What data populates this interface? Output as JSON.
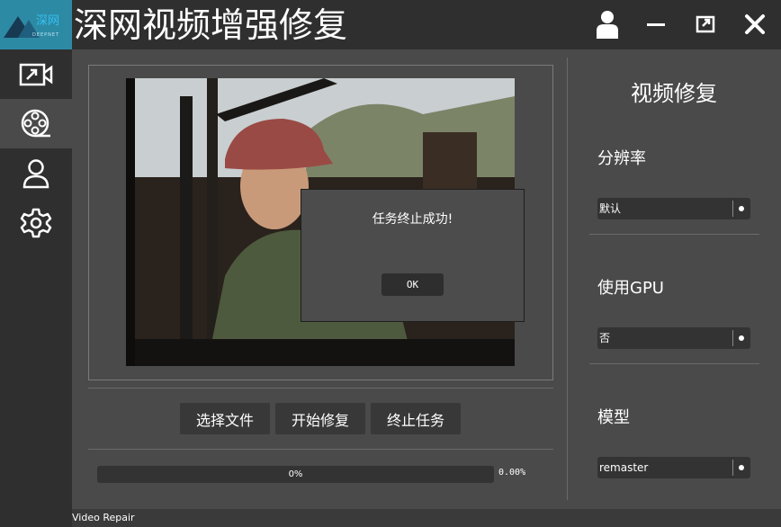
{
  "app": {
    "logo_brand": "深网",
    "logo_sub": "DEEPNET",
    "title": "深网视频增强修复"
  },
  "window_controls": [
    "user-icon",
    "minimize-icon",
    "restore-icon",
    "close-icon"
  ],
  "sidebar": {
    "items": [
      {
        "name": "video-import",
        "icon": "video-arrow-icon"
      },
      {
        "name": "video-repair",
        "icon": "film-reel-icon",
        "active": true
      },
      {
        "name": "user",
        "icon": "user-icon"
      },
      {
        "name": "settings",
        "icon": "gear-icon"
      }
    ]
  },
  "actions": {
    "select_file": "选择文件",
    "start_repair": "开始修复",
    "stop_task": "终止任务"
  },
  "progress": {
    "bar_label": "0%",
    "percent_text": "0.00%",
    "value": 0
  },
  "dialog": {
    "message": "任务终止成功!",
    "ok_label": "OK"
  },
  "settings_panel": {
    "title": "视频修复",
    "resolution": {
      "label": "分辨率",
      "value": "默认"
    },
    "gpu": {
      "label": "使用GPU",
      "value": "否"
    },
    "model": {
      "label": "模型",
      "value": "remaster"
    }
  },
  "status": {
    "text": "Video Repair"
  },
  "colors": {
    "titlebar": "#2f2f2f",
    "background": "#4a4a4a",
    "control": "#333333",
    "logo_bg": "#2d8aa5"
  }
}
